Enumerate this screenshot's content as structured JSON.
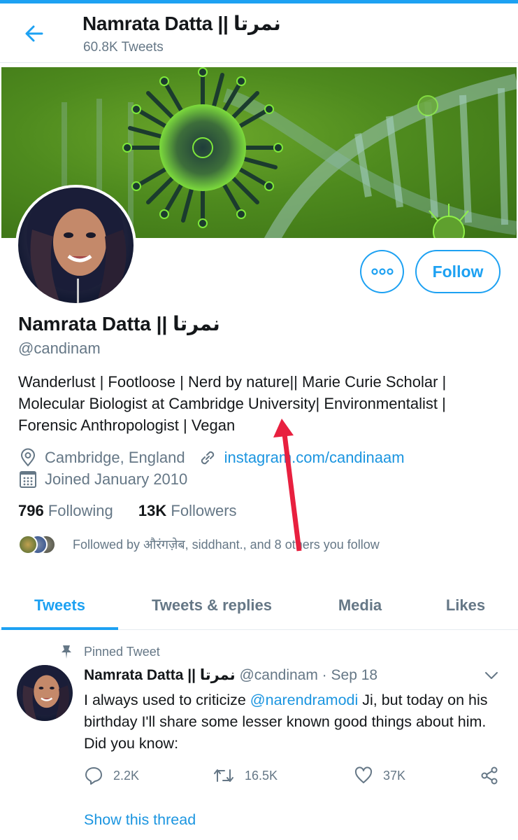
{
  "header": {
    "back_icon": "arrow-left-icon",
    "title": "Namrata Datta || نمرتا",
    "tweet_count": "60.8K Tweets"
  },
  "banner": {
    "description": "Green virus and DNA helix illustration"
  },
  "actions": {
    "more_icon": "more-options-icon",
    "follow_label": "Follow"
  },
  "profile": {
    "name": "Namrata Datta || نمرتا",
    "handle": "@candinam",
    "bio": "Wanderlust | Footloose | Nerd by nature|| Marie Curie Scholar | Molecular Biologist at Cambridge University| Environmentalist | Forensic Anthropologist | Vegan",
    "location": "Cambridge, England",
    "website": "instagram.com/candinaam",
    "joined": "Joined January 2010",
    "following_count": "796",
    "following_label": "Following",
    "followers_count": "13K",
    "followers_label": "Followers",
    "followed_by": "Followed by औरंगज़ेब, siddhant., and 8 others you follow"
  },
  "tabs": [
    {
      "label": "Tweets",
      "active": true
    },
    {
      "label": "Tweets & replies",
      "active": false
    },
    {
      "label": "Media",
      "active": false
    },
    {
      "label": "Likes",
      "active": false
    }
  ],
  "pinned_tweet": {
    "pinned_label": "Pinned Tweet",
    "author_name": "Namrata Datta || نمرتا",
    "author_handle": "@candinam",
    "separator": " · ",
    "date": "Sep 18",
    "text_before": "I always used to criticize ",
    "mention": "@narendramodi",
    "text_after": " Ji, but today on his birthday I'll share some lesser known good things about him. Did you know:",
    "replies": "2.2K",
    "retweets": "16.5K",
    "likes": "37K",
    "show_thread": "Show this thread"
  },
  "colors": {
    "accent": "#1da1f2",
    "link": "#1b95e0",
    "secondary_text": "#657786",
    "primary_text": "#14171a",
    "annotation_arrow": "#e8203f"
  }
}
